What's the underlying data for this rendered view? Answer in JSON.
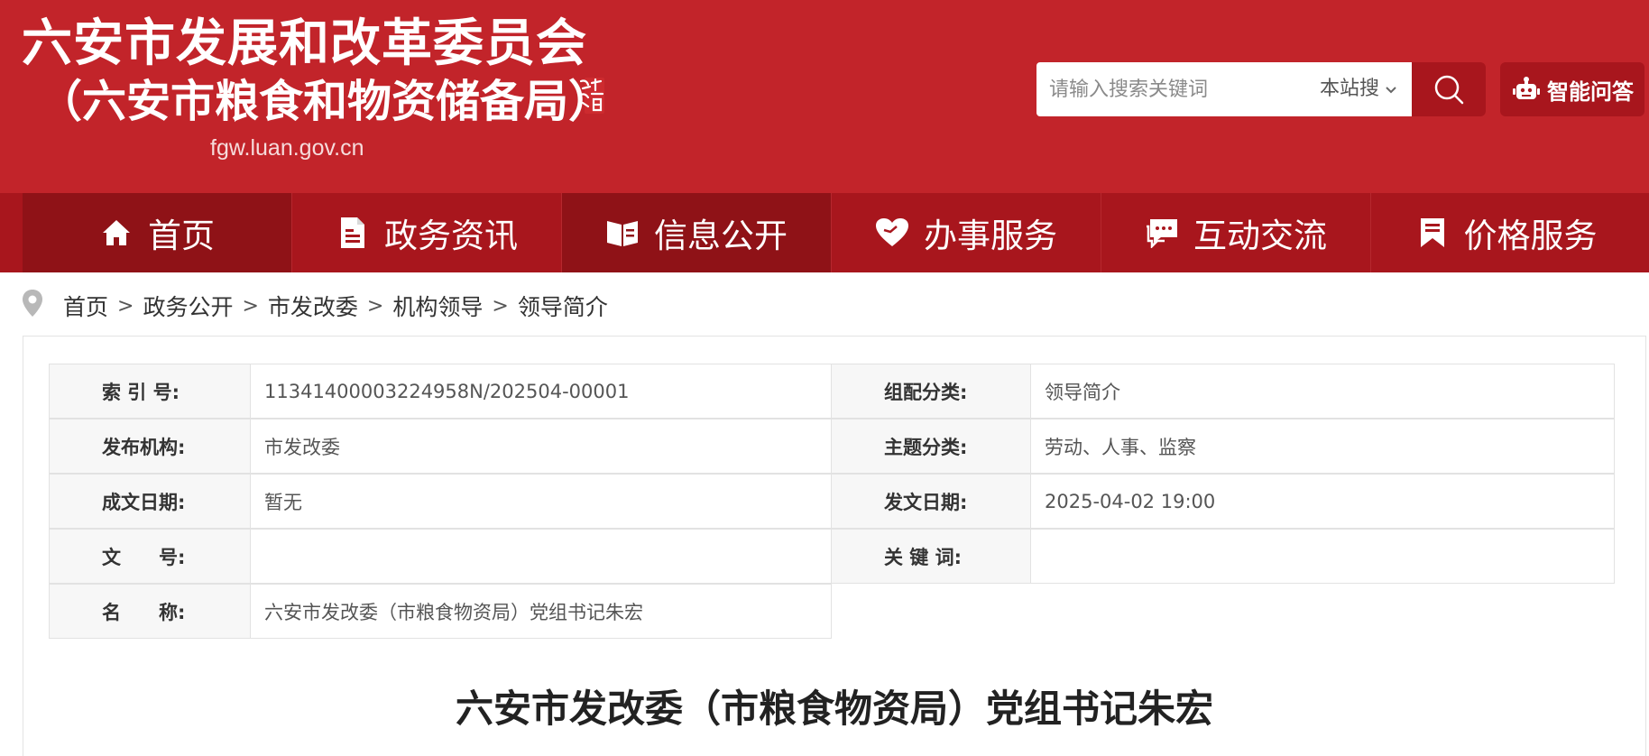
{
  "header": {
    "title": "六安市发展和改革委员会",
    "subtitle": "（六安市粮食和物资储备局）",
    "domain": "fgw.luan.gov.cn",
    "colors": {
      "brand_red": "#c2242a",
      "nav_red": "#a8161d",
      "nav_active": "#8f1217"
    }
  },
  "search": {
    "placeholder": "请输入搜索关键词",
    "scope": "本站搜",
    "button_icon": "search-icon"
  },
  "ai_button": {
    "label": "智能问答",
    "icon": "robot-icon"
  },
  "nav": {
    "items": [
      {
        "label": "首页",
        "icon": "home-icon"
      },
      {
        "label": "政务资讯",
        "icon": "document-icon"
      },
      {
        "label": "信息公开",
        "icon": "open-book-icon"
      },
      {
        "label": "办事服务",
        "icon": "heart-icon"
      },
      {
        "label": "互动交流",
        "icon": "chat-icon"
      },
      {
        "label": "价格服务",
        "icon": "bookmark-icon"
      }
    ]
  },
  "breadcrumb": {
    "icon": "location-pin-icon",
    "items": [
      "首页",
      "政务公开",
      "市发改委",
      "机构领导",
      "领导简介"
    ],
    "separator": ">"
  },
  "meta": {
    "rows": [
      {
        "l1": "索 引 号:",
        "v1": "11341400003224958N/202504-00001",
        "l2": "组配分类:",
        "v2": "领导简介"
      },
      {
        "l1": "发布机构:",
        "v1": "市发改委",
        "l2": "主题分类:",
        "v2": "劳动、人事、监察"
      },
      {
        "l1": "成文日期:",
        "v1": "暂无",
        "l2": "发文日期:",
        "v2": "2025-04-02 19:00"
      },
      {
        "l1": "文　　号:",
        "v1": "",
        "l2": "关 键 词:",
        "v2": ""
      },
      {
        "l1": "名　　称:",
        "v1": "六安市发改委（市粮食物资局）党组书记朱宏"
      }
    ]
  },
  "article": {
    "title": "六安市发改委（市粮食物资局）党组书记朱宏"
  }
}
